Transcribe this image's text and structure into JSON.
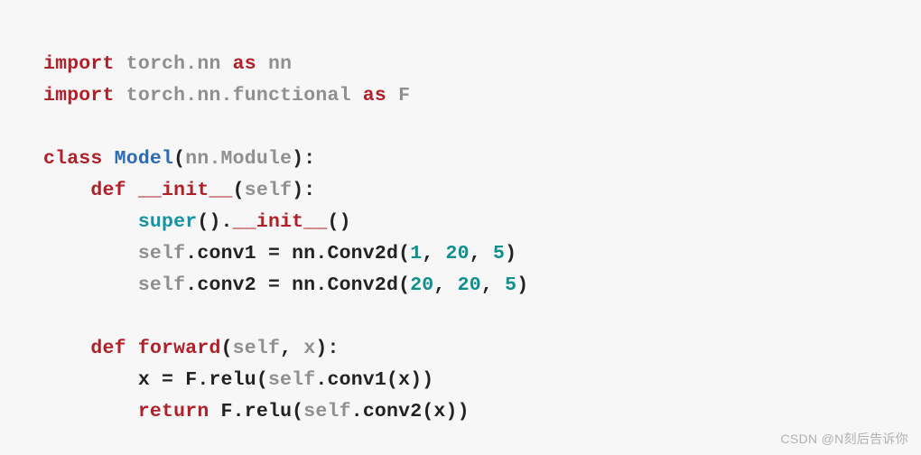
{
  "code": {
    "l1_import": "import",
    "l1_mod": "torch.nn",
    "l1_as": "as",
    "l1_alias": "nn",
    "l2_import": "import",
    "l2_mod": "torch.nn.functional",
    "l2_as": "as",
    "l2_alias": "F",
    "l4_class": "class",
    "l4_name": "Model",
    "l4_open": "(",
    "l4_base": "nn.Module",
    "l4_close": "):",
    "l5_def": "def",
    "l5_name": "__init__",
    "l5_open": "(",
    "l5_self": "self",
    "l5_close": "):",
    "l6_super": "super",
    "l6_call": "().",
    "l6_init": "__init__",
    "l6_paren": "()",
    "l7_self": "self",
    "l7_dot": ".",
    "l7_attr": "conv1 = nn.Conv2d(",
    "l7_n1": "1",
    "l7_c1": ", ",
    "l7_n2": "20",
    "l7_c2": ", ",
    "l7_n3": "5",
    "l7_close": ")",
    "l8_self": "self",
    "l8_dot": ".",
    "l8_attr": "conv2 = nn.Conv2d(",
    "l8_n1": "20",
    "l8_c1": ", ",
    "l8_n2": "20",
    "l8_c2": ", ",
    "l8_n3": "5",
    "l8_close": ")",
    "l10_def": "def",
    "l10_name": "forward",
    "l10_open": "(",
    "l10_self": "self",
    "l10_c": ", ",
    "l10_x": "x",
    "l10_close": "):",
    "l11_lhs": "x = F.relu(",
    "l11_self": "self",
    "l11_dot": ".",
    "l11_call": "conv1(x))",
    "l12_ret": "return",
    "l12_call1": " F.relu(",
    "l12_self": "self",
    "l12_dot": ".",
    "l12_call2": "conv2(x))"
  },
  "watermark": "CSDN @N刻后告诉你"
}
